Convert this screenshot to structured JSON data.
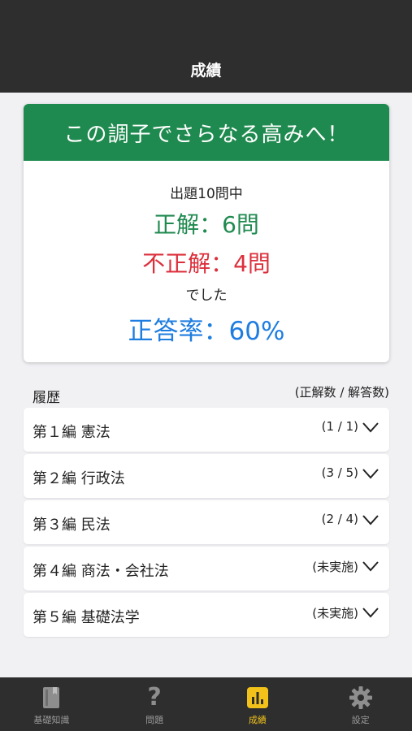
{
  "header": {
    "title": "成績"
  },
  "result": {
    "banner": "この調子でさらなる高みへ！",
    "total_line": "出題10問中",
    "correct_line": "正解：6問",
    "incorrect_line": "不正解：4問",
    "deshita": "でした",
    "rate_line": "正答率：60%",
    "colors": {
      "banner": "#1f8a4f",
      "correct": "#1f8a4f",
      "incorrect": "#dc2f3c",
      "rate": "#1e7de0"
    }
  },
  "history": {
    "heading": "履歴",
    "note": "(正解数 / 解答数)",
    "items": [
      {
        "label": "第１編 憲法",
        "score": "(1 / 1)",
        "icon": "chevron-down-icon"
      },
      {
        "label": "第２編 行政法",
        "score": "(3 / 5)",
        "icon": "chevron-down-icon"
      },
      {
        "label": "第３編 民法",
        "score": "(2 / 4)",
        "icon": "chevron-down-icon"
      },
      {
        "label": "第４編 商法・会社法",
        "score": "(未実施)",
        "icon": "chevron-down-icon"
      },
      {
        "label": "第５編 基礎法学",
        "score": "(未実施)",
        "icon": "chevron-down-icon"
      }
    ]
  },
  "tabbar": {
    "active_color": "#f2c21b",
    "tabs": [
      {
        "label": "基礎知識",
        "icon": "book-icon",
        "active": false
      },
      {
        "label": "問題",
        "icon": "question-icon",
        "active": false
      },
      {
        "label": "成績",
        "icon": "bar-chart-icon",
        "active": true
      },
      {
        "label": "設定",
        "icon": "gear-icon",
        "active": false
      }
    ]
  }
}
